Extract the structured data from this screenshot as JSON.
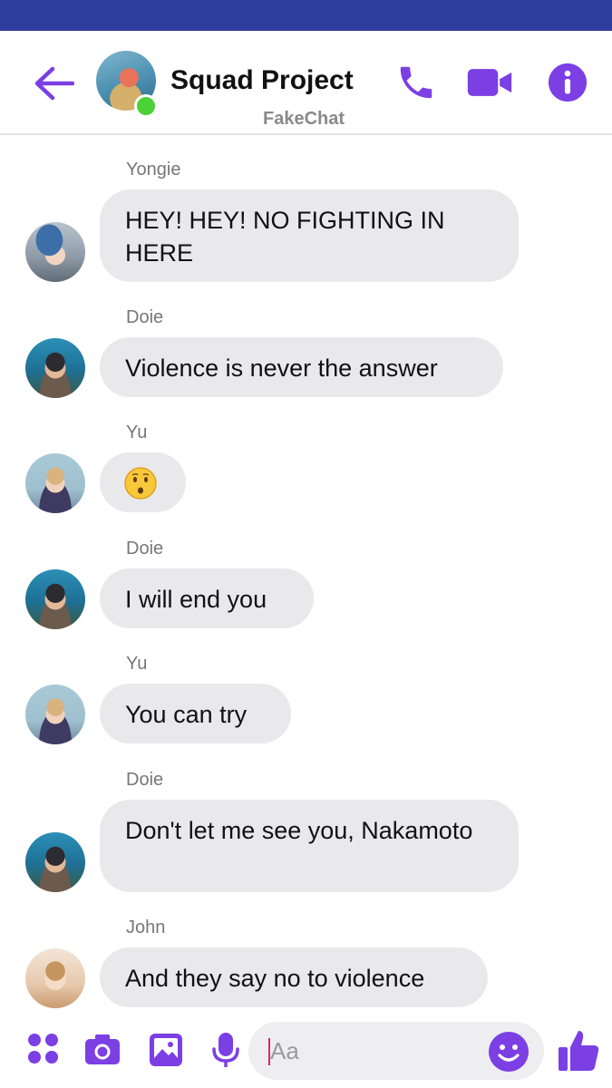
{
  "colors": {
    "status_bar": "#2f3e9e",
    "accent": "#7b3fe4",
    "bubble": "#e9e9ec",
    "online": "#4cd137"
  },
  "header": {
    "title": "Squad Project",
    "subtitle": "FakeChat",
    "icons": [
      "back-arrow-icon",
      "phone-icon",
      "video-camera-icon",
      "info-icon"
    ]
  },
  "messages": [
    {
      "sender": "Yongie",
      "text": "HEY! HEY! NO FIGHTING IN HERE"
    },
    {
      "sender": "Doie",
      "text": "Violence is never the answer"
    },
    {
      "sender": "Yu",
      "text": "",
      "emoji": "hushed-face-emoji"
    },
    {
      "sender": "Doie",
      "text": "I will end you"
    },
    {
      "sender": "Yu",
      "text": "You can try"
    },
    {
      "sender": "Doie",
      "text": "Don't let me see you, Nakamoto"
    },
    {
      "sender": "John",
      "text": "And they say no to violence"
    }
  ],
  "composer": {
    "placeholder": "Aa",
    "icons": [
      "apps-icon",
      "camera-icon",
      "gallery-icon",
      "microphone-icon",
      "smiley-icon",
      "thumbs-up-icon"
    ]
  }
}
